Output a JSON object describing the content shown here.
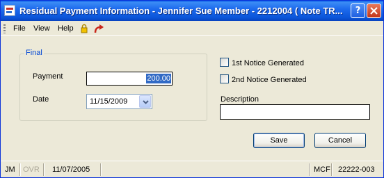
{
  "window": {
    "title": "Residual Payment Information - Jennifer Sue Member - 2212004 ( Note TR...",
    "help_label": "?",
    "close_label": "X"
  },
  "menu": {
    "items": [
      {
        "label": "File"
      },
      {
        "label": "View"
      },
      {
        "label": "Help"
      }
    ],
    "lock_icon": "lock-icon",
    "redo_icon": "redo-arrow-icon"
  },
  "final_group": {
    "legend": "Final",
    "payment_label": "Payment",
    "payment_value": "200.00",
    "date_label": "Date",
    "date_value": "11/15/2009"
  },
  "notices": {
    "first_label": "1st Notice Generated",
    "first_checked": false,
    "second_label": "2nd Notice Generated",
    "second_checked": false
  },
  "description": {
    "label": "Description",
    "value": ""
  },
  "buttons": {
    "save_label": "Save",
    "cancel_label": "Cancel"
  },
  "status": {
    "user": "JM",
    "ovr": "OVR",
    "date": "11/07/2005",
    "mode": "MCF",
    "code": "22222-003"
  },
  "colors": {
    "titlebar": "#0a54d8",
    "accent_legend": "#0046d5",
    "selection": "#316ac5"
  }
}
